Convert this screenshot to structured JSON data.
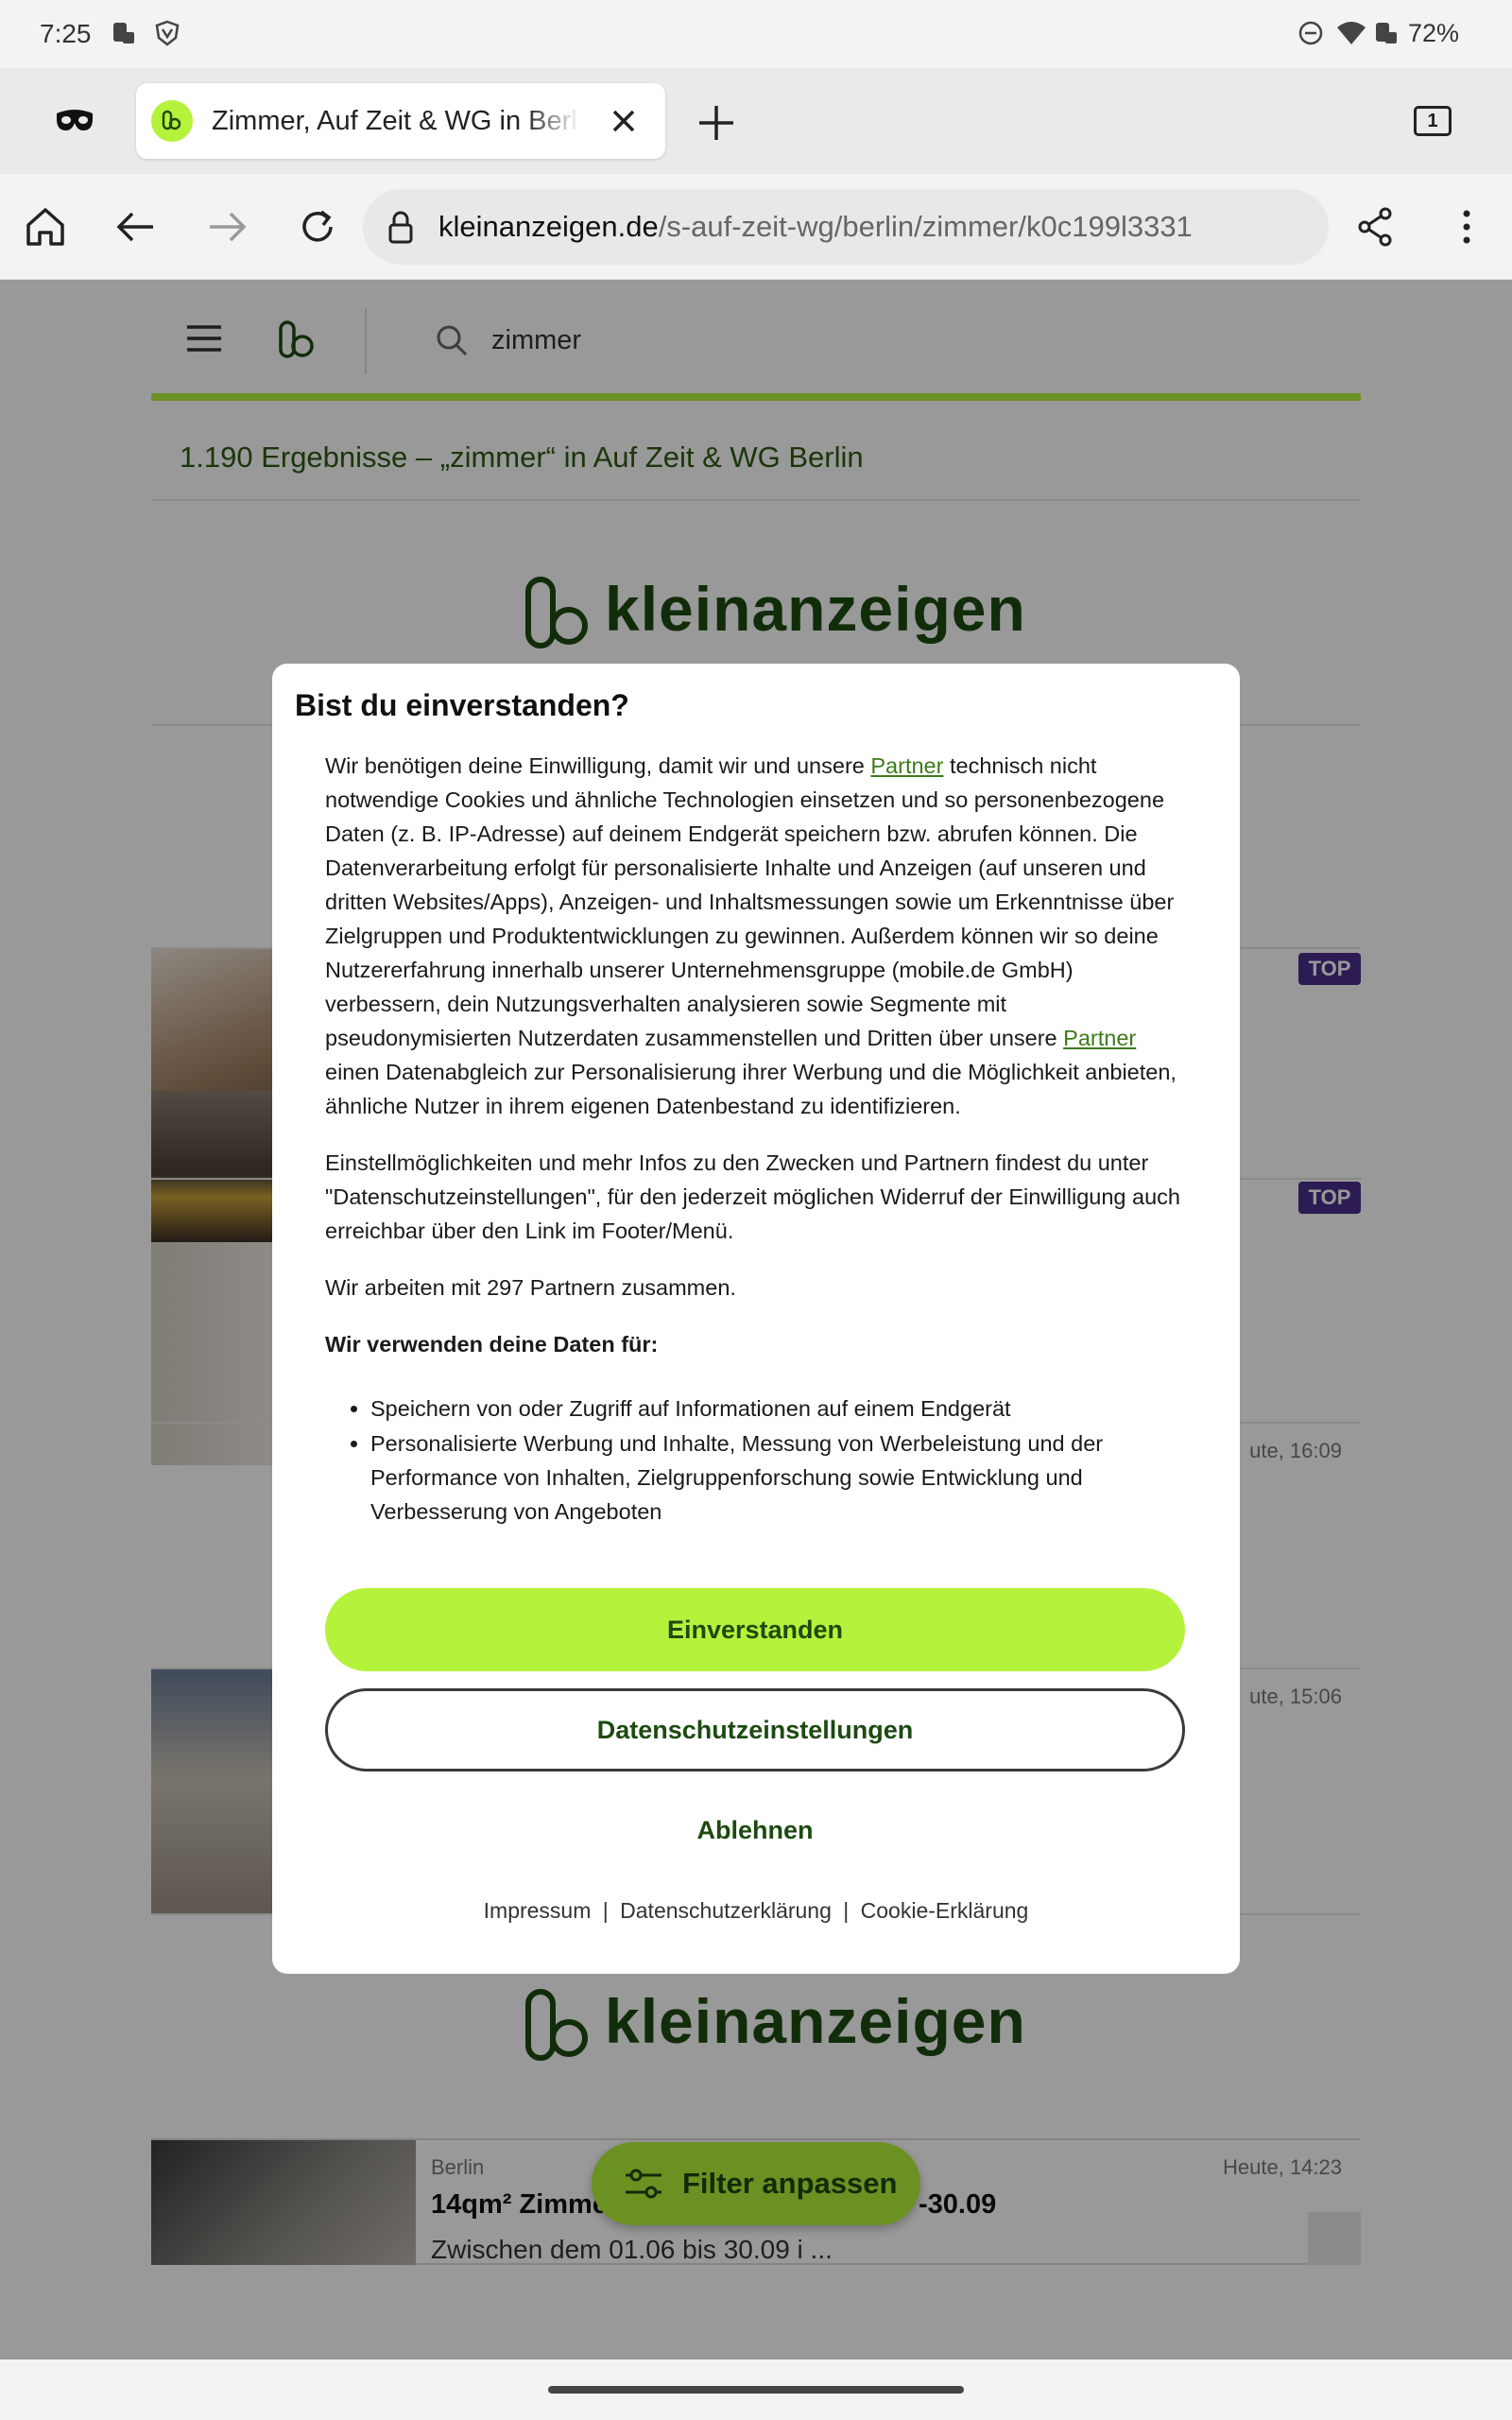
{
  "status": {
    "time": "7:25",
    "battery": "72%"
  },
  "tab": {
    "title": "Zimmer, Auf Zeit & WG in Berlin",
    "count": "1"
  },
  "url": {
    "host": "kleinanzeigen.de",
    "path": "/s-auf-zeit-wg/berlin/zimmer/k0c199l3331"
  },
  "site": {
    "search_query": "zimmer",
    "results_text": "1.190 Ergebnisse – „zimmer“ in Auf Zeit & WG Berlin",
    "brand": "kleinanzeigen",
    "top_badge": "TOP",
    "date_1": "ute, 16:09",
    "date_2": "ute, 15:06",
    "bottom_listing": {
      "location": "Berlin",
      "title": "14qm² Zimme",
      "title_end": "-30.09",
      "description": "Zwischen dem 01.06 bis 30.09 i  ...",
      "date": "Heute, 14:23"
    },
    "filter_label": "Filter anpassen"
  },
  "dialog": {
    "title": "Bist du einverstanden?",
    "p1_a": "Wir benötigen deine Einwilligung, damit wir und unsere ",
    "partner_link": "Partner",
    "p1_b": " technisch nicht notwendige Cookies und ähnliche Technologien einsetzen und so personenbezogene Daten (z. B. IP-Adresse) auf deinem Endgerät speichern bzw. abrufen können. Die Datenverarbeitung erfolgt für personalisierte Inhalte und Anzeigen (auf unseren und dritten Websites/Apps), Anzeigen- und Inhaltsmessungen sowie um Erkenntnisse über Zielgruppen und Produktentwicklungen zu gewinnen. Außerdem können wir so deine Nutzererfahrung innerhalb unserer Unternehmensgruppe (mobile.de GmbH) verbessern, dein Nutzungsverhalten analysieren sowie Segmente mit pseudonymisierten Nutzerdaten zusammenstellen und Dritten über unsere ",
    "p1_c": " einen Datenabgleich zur Personalisierung ihrer Werbung und die Möglichkeit anbieten, ähnliche Nutzer in ihrem eigenen Datenbestand zu identifizieren.",
    "p2": "Einstellmöglichkeiten und mehr Infos zu den Zwecken und Partnern findest du unter \"Datenschutzeinstellungen\", für den jederzeit möglichen Widerruf der Einwilligung auch erreichbar über den Link im Footer/Menü.",
    "p3": "Wir arbeiten mit 297 Partnern zusammen.",
    "purposes_heading": "Wir verwenden deine Daten für:",
    "purposes": [
      "Speichern von oder Zugriff auf Informationen auf einem Endgerät",
      "Personalisierte Werbung und Inhalte, Messung von Werbeleistung und der Performance von Inhalten, Zielgruppenforschung sowie Entwicklung und Verbesserung von Angeboten"
    ],
    "accept_label": "Einverstanden",
    "settings_label": "Datenschutzeinstellungen",
    "reject_label": "Ablehnen",
    "footer": {
      "imprint": "Impressum",
      "separator": "|",
      "privacy": "Datenschutzerklärung",
      "cookie": "Cookie-Erklärung"
    }
  },
  "colors": {
    "accent": "#b5f23b",
    "brand_dark": "#1d4a10",
    "link": "#3d7a1a",
    "badge": "#4b2f8a"
  }
}
